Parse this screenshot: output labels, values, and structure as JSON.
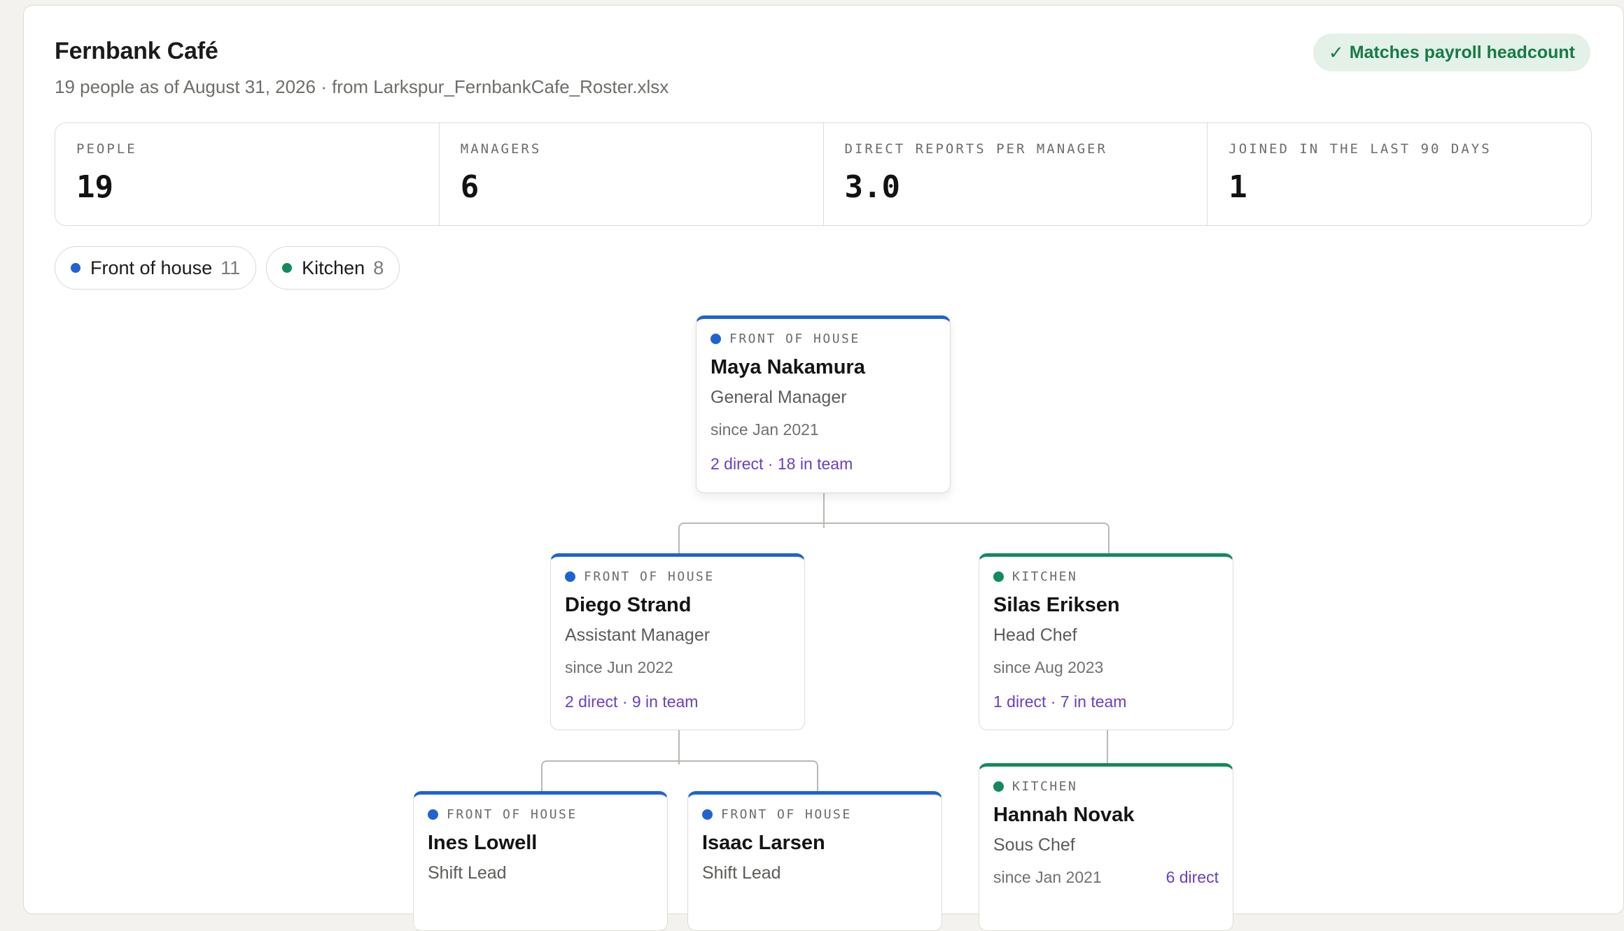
{
  "header": {
    "title": "Fernbank Café",
    "subtitle": "19 people as of August 31, 2026 · from Larkspur_FernbankCafe_Roster.xlsx",
    "badge": "Matches payroll headcount",
    "badge_icon": "check-icon"
  },
  "stats": [
    {
      "label": "PEOPLE",
      "value": "19"
    },
    {
      "label": "MANAGERS",
      "value": "6"
    },
    {
      "label": "DIRECT REPORTS PER MANAGER",
      "value": "3.0"
    },
    {
      "label": "JOINED IN THE LAST 90 DAYS",
      "value": "1"
    }
  ],
  "filters": [
    {
      "label": "Front of house",
      "count": "11",
      "color": "#1f63d2"
    },
    {
      "label": "Kitchen",
      "count": "8",
      "color": "#138a5c"
    }
  ],
  "colors": {
    "front_of_house": "#1f63d2",
    "kitchen": "#138a5c",
    "team_link": "#6a3fc1"
  },
  "org": {
    "maya": {
      "dept": "FRONT OF HOUSE",
      "name": "Maya Nakamura",
      "role": "General Manager",
      "since": "since Jan 2021",
      "team": "2 direct · 18 in team"
    },
    "diego": {
      "dept": "FRONT OF HOUSE",
      "name": "Diego Strand",
      "role": "Assistant Manager",
      "since": "since Jun 2022",
      "team": "2 direct · 9 in team"
    },
    "silas": {
      "dept": "KITCHEN",
      "name": "Silas Eriksen",
      "role": "Head Chef",
      "since": "since Aug 2023",
      "team": "1 direct · 7 in team"
    },
    "ines": {
      "dept": "FRONT OF HOUSE",
      "name": "Ines Lowell",
      "role": "Shift Lead"
    },
    "isaac": {
      "dept": "FRONT OF HOUSE",
      "name": "Isaac Larsen",
      "role": "Shift Lead"
    },
    "hannah": {
      "dept": "KITCHEN",
      "name": "Hannah Novak",
      "role": "Sous Chef",
      "since": "since Jan 2021",
      "team": "6 direct"
    }
  }
}
